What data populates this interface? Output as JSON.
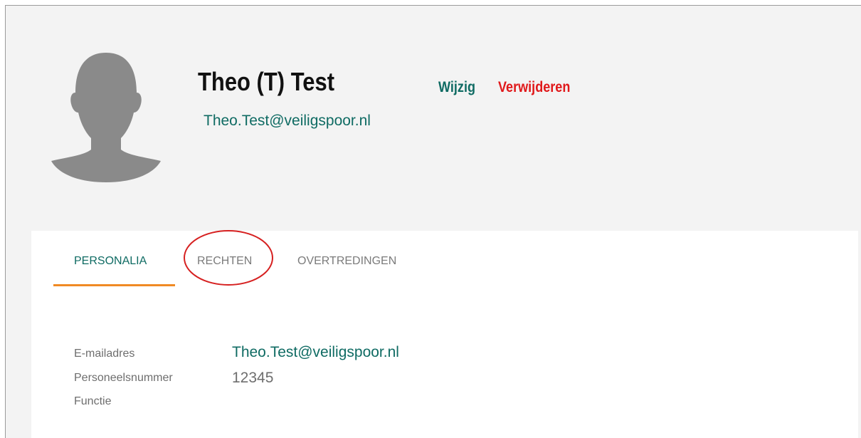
{
  "profile": {
    "name": "Theo (T) Test",
    "email": "Theo.Test@veiligspoor.nl",
    "avatar_icon": "user-silhouette-icon"
  },
  "actions": {
    "edit_label": "Wijzig",
    "delete_label": "Verwijderen"
  },
  "tabs": [
    {
      "label": "PERSONALIA",
      "active": true
    },
    {
      "label": "RECHTEN",
      "active": false
    },
    {
      "label": "OVERTREDINGEN",
      "active": false
    }
  ],
  "details": {
    "email_label": "E-mailadres",
    "email_value": "Theo.Test@veiligspoor.nl",
    "personnel_label": "Personeelsnummer",
    "personnel_value": "12345",
    "function_label": "Functie",
    "function_value": ""
  },
  "colors": {
    "brand_teal": "#0f6b63",
    "danger_red": "#e0191b",
    "tab_accent_orange": "#f08a24",
    "annotation_red": "#d62020",
    "header_background": "#f3f3f3",
    "avatar_gray": "#8a8a8a"
  }
}
